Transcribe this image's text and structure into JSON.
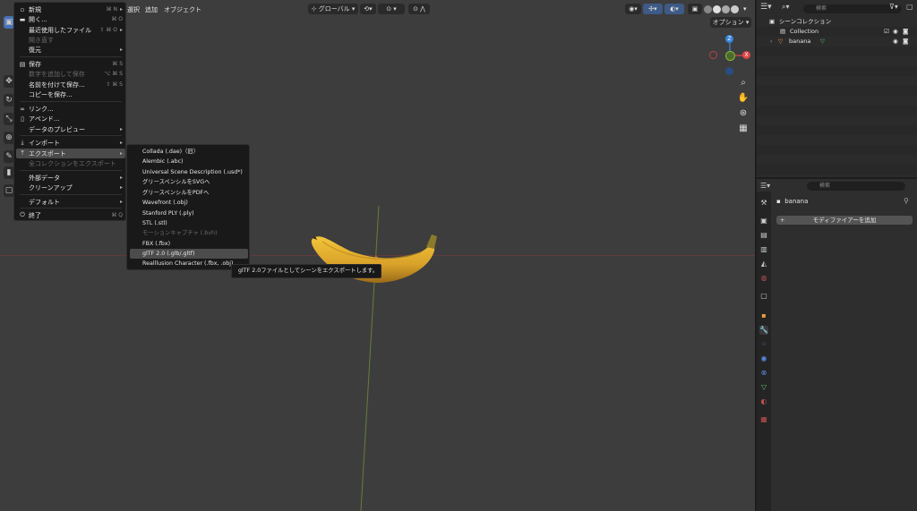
{
  "viewport": {
    "menubar": [
      "選択",
      "追加",
      "オブジェクト"
    ],
    "transform_orientation": "グローバル",
    "options_label": "オプション"
  },
  "file_menu": {
    "items": [
      {
        "icon": "new-file-icon",
        "label": "新規",
        "shortcut": "⌘ N",
        "arrow": "▸",
        "disabled": false
      },
      {
        "icon": "folder-icon",
        "label": "開く...",
        "shortcut": "⌘ O",
        "arrow": "",
        "disabled": false
      },
      {
        "icon": "",
        "label": "最近使用したファイル",
        "shortcut": "⇧ ⌘ O",
        "arrow": "▸",
        "disabled": false
      },
      {
        "icon": "",
        "label": "開き直す",
        "shortcut": "",
        "arrow": "",
        "disabled": true
      },
      {
        "icon": "",
        "label": "復元",
        "shortcut": "",
        "arrow": "▸",
        "disabled": false
      },
      {
        "icon": "save-icon",
        "label": "保存",
        "shortcut": "⌘ S",
        "arrow": "",
        "disabled": false
      },
      {
        "icon": "",
        "label": "数字を追加して保存",
        "shortcut": "⌥ ⌘ S",
        "arrow": "",
        "disabled": true
      },
      {
        "icon": "",
        "label": "名前を付けて保存...",
        "shortcut": "⇧ ⌘ S",
        "arrow": "",
        "disabled": false
      },
      {
        "icon": "",
        "label": "コピーを保存...",
        "shortcut": "",
        "arrow": "",
        "disabled": false
      },
      {
        "icon": "link-icon",
        "label": "リンク...",
        "shortcut": "",
        "arrow": "",
        "disabled": false
      },
      {
        "icon": "append-icon",
        "label": "アペンド...",
        "shortcut": "",
        "arrow": "",
        "disabled": false
      },
      {
        "icon": "",
        "label": "データのプレビュー",
        "shortcut": "",
        "arrow": "▸",
        "disabled": false
      },
      {
        "icon": "import-icon",
        "label": "インポート",
        "shortcut": "",
        "arrow": "▸",
        "disabled": false
      },
      {
        "icon": "export-icon",
        "label": "エクスポート",
        "shortcut": "",
        "arrow": "▸",
        "disabled": false
      },
      {
        "icon": "",
        "label": "全コレクションをエクスポート",
        "shortcut": "",
        "arrow": "",
        "disabled": true
      },
      {
        "icon": "",
        "label": "外部データ",
        "shortcut": "",
        "arrow": "▸",
        "disabled": false
      },
      {
        "icon": "",
        "label": "クリーンアップ",
        "shortcut": "",
        "arrow": "▸",
        "disabled": false
      },
      {
        "icon": "",
        "label": "デフォルト",
        "shortcut": "",
        "arrow": "▸",
        "disabled": false
      },
      {
        "icon": "power-icon",
        "label": "終了",
        "shortcut": "⌘ Q",
        "arrow": "",
        "disabled": false
      }
    ]
  },
  "export_menu": {
    "items": [
      {
        "label": "Collada (.dae)（旧）",
        "disabled": false
      },
      {
        "label": "Alembic (.abc)",
        "disabled": false
      },
      {
        "label": "Universal Scene Description (.usd*)",
        "disabled": false
      },
      {
        "label": "グリースペンシルをSVGへ",
        "disabled": false
      },
      {
        "label": "グリースペンシルをPDFへ",
        "disabled": false
      },
      {
        "label": "Wavefront (.obj)",
        "disabled": false
      },
      {
        "label": "Stanford PLY (.ply)",
        "disabled": false
      },
      {
        "label": "STL (.stl)",
        "disabled": false
      },
      {
        "label": "モーションキャプチャ (.bvh)",
        "disabled": true
      },
      {
        "label": "FBX (.fbx)",
        "disabled": false
      },
      {
        "label": "glTF 2.0 (.glb/.gltf)",
        "disabled": false
      },
      {
        "label": "Realllusion Character (.fbx, .obj)",
        "disabled": false
      }
    ],
    "tooltip": "glTF 2.0ファイルとしてシーンをエクスポートします。"
  },
  "outliner": {
    "search_placeholder": "検索",
    "scene_collection": "シーンコレクション",
    "collection": "Collection",
    "object": "banana"
  },
  "properties": {
    "search_placeholder": "検索",
    "object_name": "banana",
    "add_modifier": "モディファイアーを追加"
  },
  "colors": {
    "viewport_bg": "#3d3d3d",
    "menu_bg": "#191919",
    "highlight": "#4a4a4a",
    "axis_x": "#e0464a",
    "axis_y": "#84b83a",
    "axis_z": "#3a86e0",
    "accent": "#4772b3"
  }
}
